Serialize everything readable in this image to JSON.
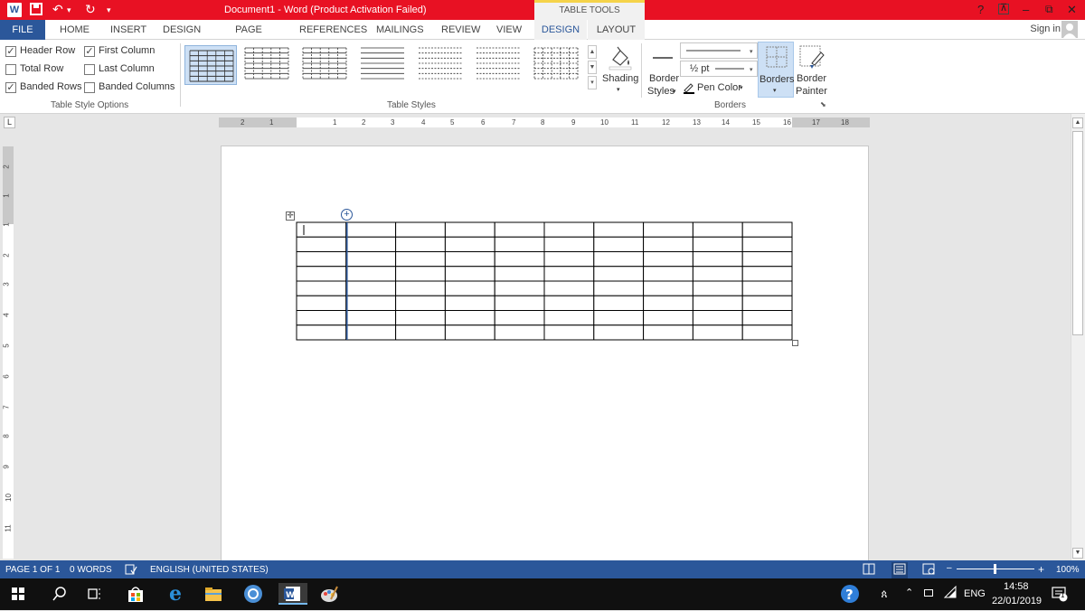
{
  "titlebar": {
    "doc_title": "Document1 -  Word (Product Activation Failed)",
    "contextual_group": "TABLE TOOLS",
    "help": "?",
    "restore_ribbon": "⊼",
    "minimize": "–",
    "maximize": "⧉",
    "close": "✕"
  },
  "tabs": {
    "file": "FILE",
    "home": "HOME",
    "insert": "INSERT",
    "design": "DESIGN",
    "page_layout": "PAGE LAYOUT",
    "references": "REFERENCES",
    "mailings": "MAILINGS",
    "review": "REVIEW",
    "view": "VIEW",
    "table_design": "DESIGN",
    "table_layout": "LAYOUT",
    "sign_in": "Sign in"
  },
  "table_style_options": {
    "header_row": {
      "label": "Header Row",
      "checked": true
    },
    "first_column": {
      "label": "First Column",
      "checked": true
    },
    "total_row": {
      "label": "Total Row",
      "checked": false
    },
    "last_column": {
      "label": "Last Column",
      "checked": false
    },
    "banded_rows": {
      "label": "Banded Rows",
      "checked": true
    },
    "banded_columns": {
      "label": "Banded Columns",
      "checked": false
    },
    "group_label": "Table Style Options"
  },
  "table_styles": {
    "group_label": "Table Styles",
    "count": 7
  },
  "shading": {
    "label": "Shading"
  },
  "borders_group": {
    "border_styles_line1": "Border",
    "border_styles_line2": "Styles",
    "weight": "½ pt",
    "pen_color": "Pen Color",
    "borders": "Borders",
    "border_painter_line1": "Border",
    "border_painter_line2": "Painter",
    "group_label": "Borders"
  },
  "ruler": {
    "h_numbers": [
      "2",
      "1",
      "1",
      "2",
      "3",
      "4",
      "5",
      "6",
      "7",
      "8",
      "9",
      "10",
      "11",
      "12",
      "13",
      "14",
      "15",
      "16",
      "17",
      "18"
    ],
    "v_numbers": [
      "2",
      "1",
      "1",
      "2",
      "3",
      "4",
      "5",
      "6",
      "7",
      "8",
      "9",
      "10",
      "11"
    ]
  },
  "document": {
    "table_rows": 8,
    "table_cols": 10
  },
  "status": {
    "page": "PAGE 1 OF 1",
    "words": "0 WORDS",
    "language": "ENGLISH (UNITED STATES)",
    "zoom": "100%",
    "zoom_minus": "–",
    "zoom_plus": "+"
  },
  "taskbar": {
    "time": "14:58",
    "date": "22/01/2019",
    "lang": "ENG",
    "notifications": "1"
  },
  "colors": {
    "title_bar": "#e81123",
    "accent": "#2b579a",
    "taskbar": "#101010"
  }
}
